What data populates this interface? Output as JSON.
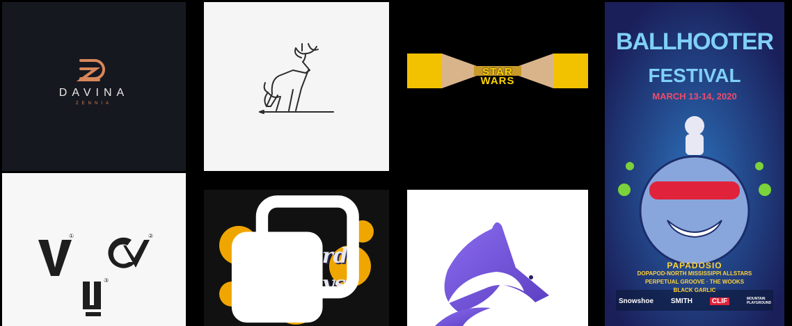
{
  "colors": {
    "davina_bg": "#161820",
    "davina_accent": "#d8875a",
    "light_bg": "#f5f5f5",
    "yellow": "#f2c200",
    "poster_bg": "#14305e",
    "poster_red": "#e0233b",
    "poster_yellow": "#ffd23a",
    "fox_purple": "#7b5ad8"
  },
  "tiles": {
    "davina": {
      "name": "DAVINA",
      "sub": "ZENNIA"
    },
    "deer": {
      "icon": "deer-line-logo"
    },
    "starwars": {
      "line1": "STAR",
      "line2": "WARS"
    },
    "monograms": {
      "a_sup": "①",
      "b_sup": "②",
      "c_sup": "③"
    },
    "hartford": {
      "line1": "Hartford",
      "line2": "Cityboys",
      "icon": "multiple-images-icon"
    },
    "fox": {
      "icon": "fox-logo"
    },
    "poster": {
      "title1": "BALLHOOTER",
      "title2": "FESTIVAL",
      "date": "MARCH 13-14, 2020",
      "headliner": "PAPADOSIO",
      "line1": "DOPAPOD·NORTH MISSISSIPPI ALLSTARS",
      "line2": "PERPETUAL GROOVE · THE WOOKS",
      "line3": "BLACK GARLIC",
      "sponsor1": "Snowshoe",
      "sponsor2": "SMITH",
      "sponsor3": "CLIF",
      "sponsor4": "MOUNTAIN PLAYGROUND"
    }
  }
}
